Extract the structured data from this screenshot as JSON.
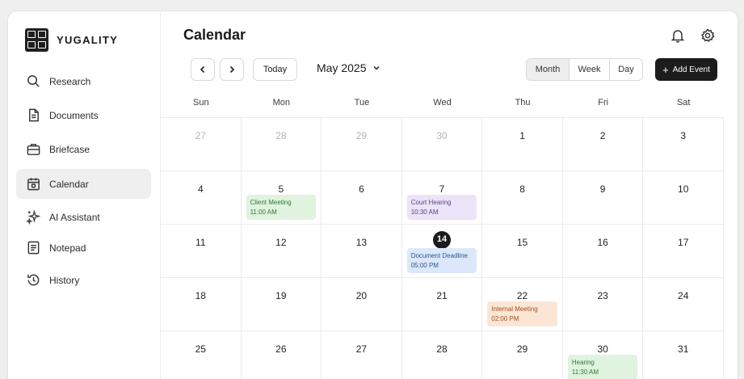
{
  "brand": {
    "name": "YUGALITY"
  },
  "sidebar": {
    "items": [
      {
        "label": "Research",
        "icon": "search-icon"
      },
      {
        "label": "Documents",
        "icon": "document-icon"
      },
      {
        "label": "Briefcase",
        "icon": "briefcase-icon"
      },
      {
        "label": "Calendar",
        "icon": "calendar-icon",
        "active": true
      },
      {
        "label": "AI Assistant",
        "icon": "sparkles-icon"
      },
      {
        "label": "Notepad",
        "icon": "notepad-icon"
      },
      {
        "label": "History",
        "icon": "history-icon"
      }
    ]
  },
  "header": {
    "title": "Calendar"
  },
  "toolbar": {
    "today_label": "Today",
    "month_label": "May 2025",
    "views": [
      "Month",
      "Week",
      "Day"
    ],
    "active_view": "Month",
    "add_event_label": "Add Event"
  },
  "calendar": {
    "weekdays": [
      "Sun",
      "Mon",
      "Tue",
      "Wed",
      "Thu",
      "Fri",
      "Sat"
    ],
    "today": 14,
    "days": [
      {
        "day": "27",
        "muted": true
      },
      {
        "day": "28",
        "muted": true
      },
      {
        "day": "29",
        "muted": true
      },
      {
        "day": "30",
        "muted": true
      },
      {
        "day": "1"
      },
      {
        "day": "2"
      },
      {
        "day": "3"
      },
      {
        "day": "4"
      },
      {
        "day": "5",
        "event": {
          "title": "Client Meeting",
          "time": "11:00 AM",
          "color": "green"
        }
      },
      {
        "day": "6"
      },
      {
        "day": "7",
        "event": {
          "title": "Court Hearing",
          "time": "10:30 AM",
          "color": "purple"
        }
      },
      {
        "day": "8"
      },
      {
        "day": "9"
      },
      {
        "day": "10"
      },
      {
        "day": "11"
      },
      {
        "day": "12"
      },
      {
        "day": "13"
      },
      {
        "day": "14",
        "today": true,
        "event": {
          "title": "Document Deadline",
          "time": "05:00 PM",
          "color": "blue"
        }
      },
      {
        "day": "15"
      },
      {
        "day": "16"
      },
      {
        "day": "17"
      },
      {
        "day": "18"
      },
      {
        "day": "19"
      },
      {
        "day": "20"
      },
      {
        "day": "21"
      },
      {
        "day": "22",
        "event": {
          "title": "Internal Meeting",
          "time": "02:00 PM",
          "color": "orange"
        }
      },
      {
        "day": "23"
      },
      {
        "day": "24"
      },
      {
        "day": "25"
      },
      {
        "day": "26"
      },
      {
        "day": "27"
      },
      {
        "day": "28"
      },
      {
        "day": "29"
      },
      {
        "day": "30",
        "event": {
          "title": "Hearing",
          "time": "11:30 AM",
          "color": "green"
        }
      },
      {
        "day": "31"
      }
    ]
  },
  "colors": {
    "accent": "#1c1c1c",
    "event_green": "#dff3df",
    "event_purple": "#ebe3f7",
    "event_blue": "#dce8fa",
    "event_orange": "#fbe6d6"
  }
}
